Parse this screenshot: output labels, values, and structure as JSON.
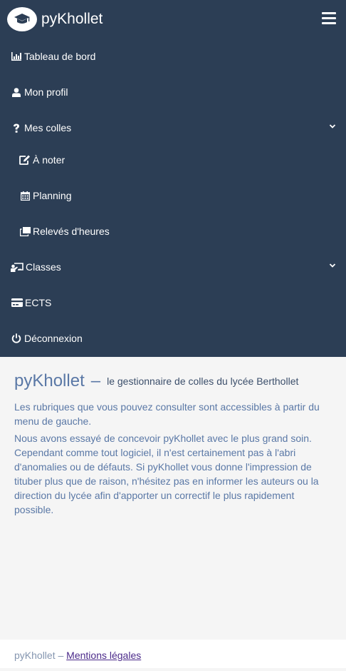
{
  "header": {
    "brand": "pyKhollet",
    "logo_icon": "graduation-cap-icon",
    "menu_icon": "hamburger-menu-icon"
  },
  "nav": {
    "items": [
      {
        "label": "Tableau de bord",
        "icon": "bar-chart-icon"
      },
      {
        "label": "Mon profil",
        "icon": "user-icon"
      },
      {
        "label": "Mes colles",
        "icon": "question-icon",
        "expandable": true
      },
      {
        "label": "À noter",
        "icon": "edit-icon"
      },
      {
        "label": "Planning",
        "icon": "calendar-icon"
      },
      {
        "label": "Relevés d'heures",
        "icon": "clone-icon"
      },
      {
        "label": "Classes",
        "icon": "chalkboard-teacher-icon",
        "expandable": true
      },
      {
        "label": "ECTS",
        "icon": "credit-card-icon"
      },
      {
        "label": "Déconnexion",
        "icon": "power-off-icon"
      }
    ]
  },
  "main": {
    "title": "pyKhollet",
    "dash": "–",
    "subtitle": "le gestionnaire de colles du lycée Berthollet",
    "paragraph1": "Les rubriques que vous pouvez consulter sont accessibles à partir du menu de gauche.",
    "paragraph2": "Nous avons essayé de concevoir pyKhollet avec le plus grand soin. Cependant comme tout logiciel, il n'est certainement pas à l'abri d'anomalies ou de défauts. Si pyKhollet vous donne l'impression de tituber plus que de raison, n'hésitez pas en informer les auteurs ou la direction du lycée afin d'apporter un correctif le plus rapidement possible."
  },
  "footer": {
    "prefix": "pyKhollet –",
    "link": "Mentions légales"
  },
  "colors": {
    "navbar": "#2c3e55",
    "text_accent": "#5a78a6",
    "link": "#4b2a8a"
  }
}
